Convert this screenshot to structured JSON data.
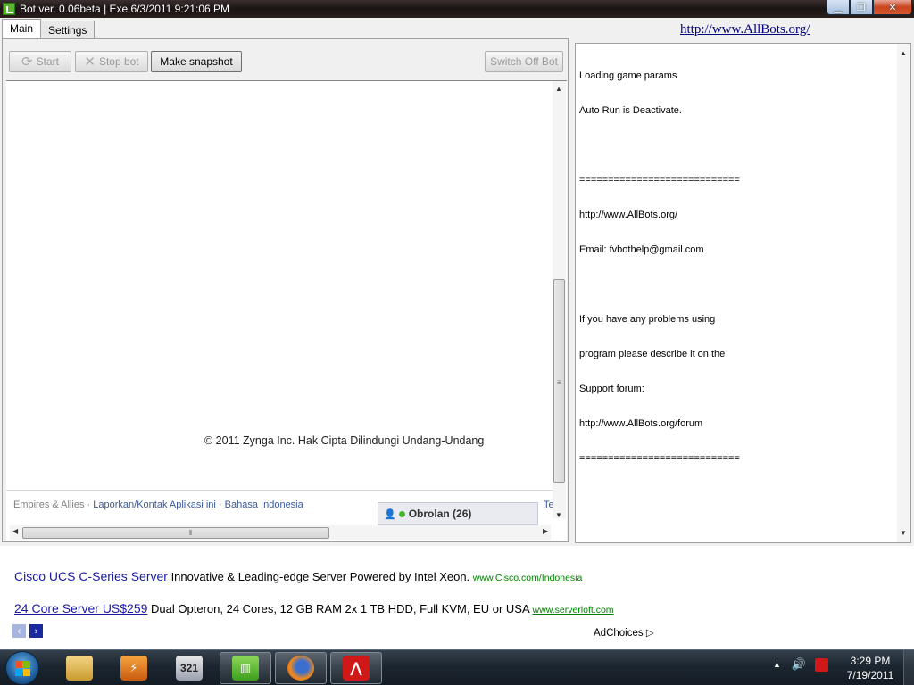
{
  "window": {
    "title": "Bot ver. 0.06beta | Exe 6/3/2011 9:21:06 PM"
  },
  "tabs": [
    {
      "label": "Main"
    },
    {
      "label": "Settings"
    }
  ],
  "toolbar": {
    "start_label": "Start",
    "stop_label": "Stop bot",
    "snapshot_label": "Make snapshot",
    "switch_off_label": "Switch Off Bot"
  },
  "game": {
    "copyright": "© 2011 Zynga Inc. Hak Cipta Dilindungi Undang-Undang",
    "footer": {
      "app_name": "Empires & Allies",
      "report_link": "Laporkan/Kontak Aplikasi ini",
      "language_link": "Bahasa Indonesia",
      "truncated_link": "Te",
      "chat_label": "Obrolan (26)"
    }
  },
  "right_panel": {
    "url": "http://www.AllBots.org/",
    "log_lines": [
      "Loading game params",
      "Auto Run is Deactivate.",
      "",
      "============================",
      "http://www.AllBots.org/",
      "Email: fvbothelp@gmail.com",
      "",
      "If you have any problems using",
      "program please describe it on the",
      "Support forum:",
      "http://www.AllBots.org/forum",
      "============================"
    ]
  },
  "ads": [
    {
      "title": "Cisco UCS C-Series Server",
      "text": "Innovative & Leading-edge Server Powered by Intel Xeon.",
      "url": "www.Cisco.com/Indonesia"
    },
    {
      "title": "24 Core Server US$259",
      "text": "Dual Opteron, 24 Cores, 12 GB RAM 2x 1 TB HDD, Full KVM, EU or USA",
      "url": "www.serverloft.com"
    }
  ],
  "adchoices_label": "AdChoices",
  "taskbar": {
    "items": [
      "windows-explorer",
      "winamp",
      "media-player-classic",
      "bot-app",
      "firefox",
      "avira-antivirus"
    ],
    "clock_time": "3:29 PM",
    "clock_date": "7/19/2011"
  },
  "colors": {
    "link_blue": "#3b5998",
    "ad_title": "#1a1aa6",
    "ad_url": "#008000",
    "bot_green": "#5cb531"
  }
}
